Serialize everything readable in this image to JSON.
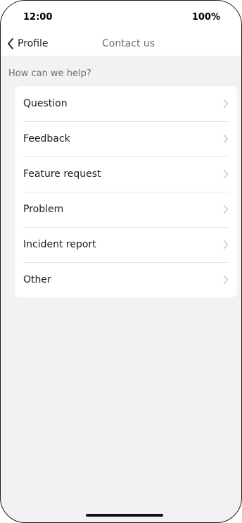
{
  "status_bar": {
    "time": "12:00",
    "battery": "100%"
  },
  "nav": {
    "back_label": "Profile",
    "title": "Contact us",
    "back_icon": "chevron-left-icon"
  },
  "section": {
    "header": "How can we help?"
  },
  "items": [
    {
      "label": "Question",
      "icon": "chevron-right-icon"
    },
    {
      "label": "Feedback",
      "icon": "chevron-right-icon"
    },
    {
      "label": "Feature request",
      "icon": "chevron-right-icon"
    },
    {
      "label": "Problem",
      "icon": "chevron-right-icon"
    },
    {
      "label": "Incident report",
      "icon": "chevron-right-icon"
    },
    {
      "label": "Other",
      "icon": "chevron-right-icon"
    }
  ],
  "colors": {
    "background": "#f2f2f4",
    "card": "#ffffff",
    "text": "#1c1c1e",
    "secondary_text": "#6d6d72",
    "chevron": "#c7c7cc"
  }
}
